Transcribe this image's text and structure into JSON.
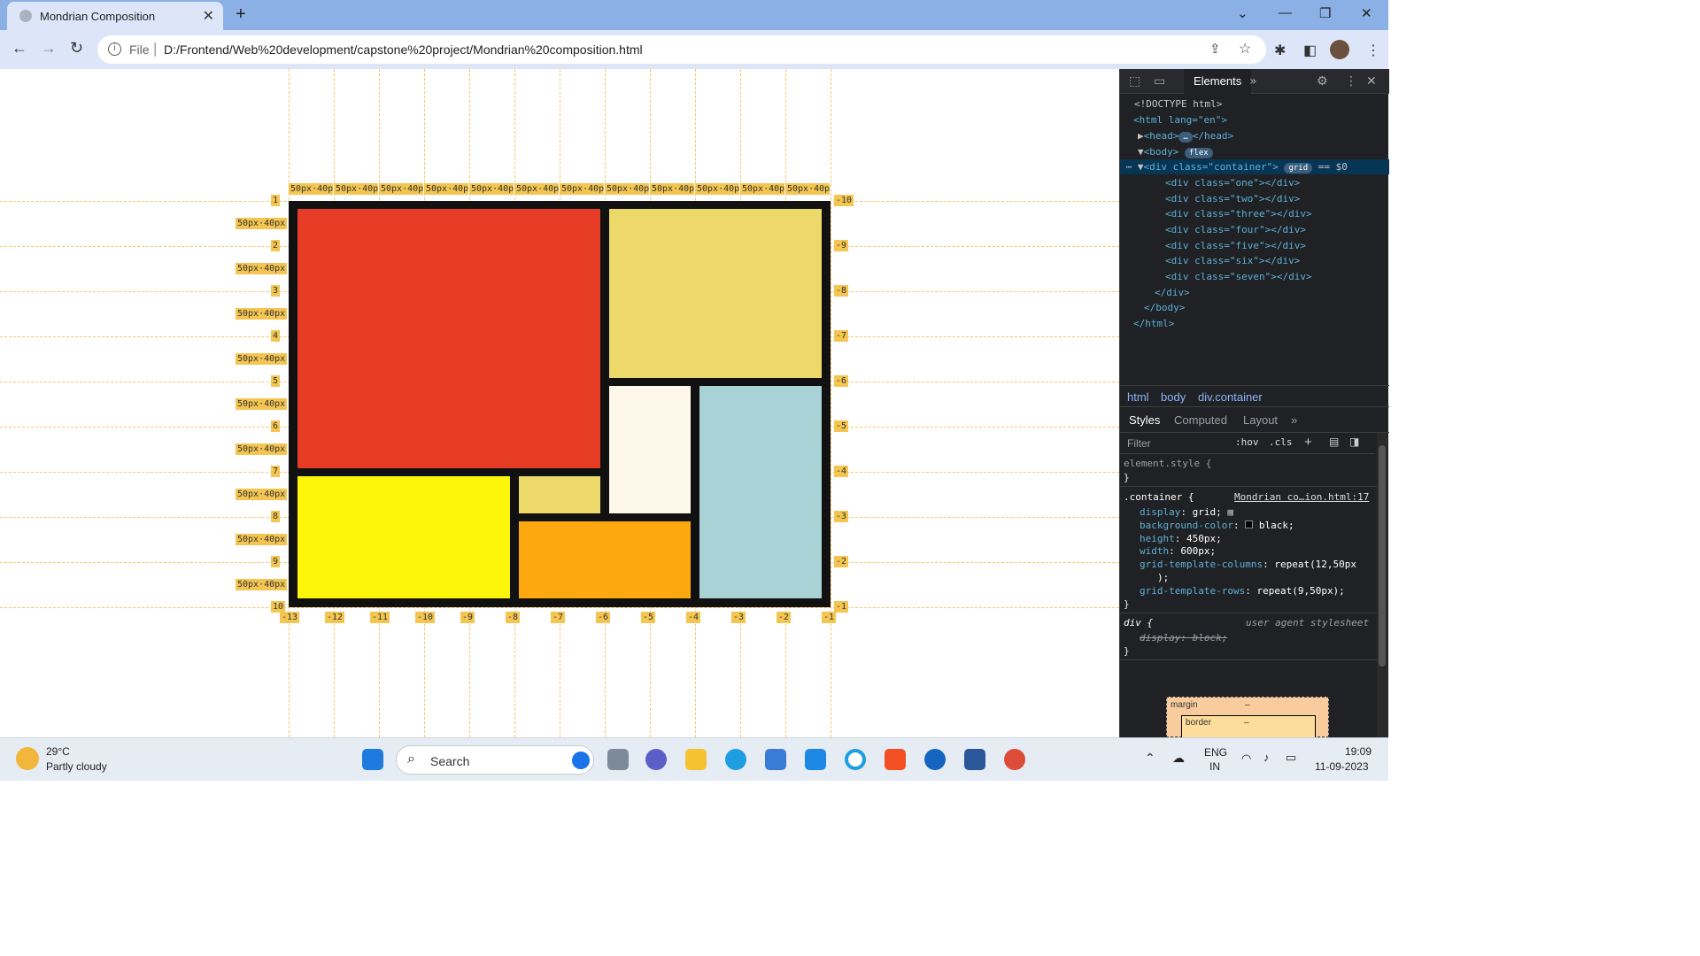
{
  "browser": {
    "tab_title": "Mondrian Composition",
    "new_tab": "+",
    "url_scheme": "File",
    "url": "D:/Frontend/Web%20development/capstone%20project/Mondrian%20composition.html"
  },
  "grid_overlay": {
    "track_label": "50px·40px",
    "row_lines_positive": [
      "1",
      "2",
      "3",
      "4",
      "5",
      "6",
      "7",
      "8",
      "9",
      "10"
    ],
    "row_lines_negative": [
      "-10",
      "-9",
      "-8",
      "-7",
      "-6",
      "-5",
      "-4",
      "-3",
      "-2",
      "-1"
    ],
    "col_lines_negative": [
      "-13",
      "-12",
      "-11",
      "-10",
      "-9",
      "-8",
      "-7",
      "-6",
      "-5",
      "-4",
      "-3",
      "-2",
      "-1"
    ],
    "colors": {
      "red": "#e63c26",
      "light_yellow": "#ecd96a",
      "cream": "#fdf8ea",
      "light_blue": "#a9d2d6",
      "yellow": "#fef60a",
      "orange": "#fda80f"
    }
  },
  "devtools": {
    "panel_tab": "Elements",
    "dom": [
      "<!DOCTYPE html>",
      "<html lang=\"en\">",
      "<head>",
      "</head>",
      "<body>",
      "<div class=\"container\">",
      "== $0",
      "<div class=\"one\"></div>",
      "<div class=\"two\"></div>",
      "<div class=\"three\"></div>",
      "<div class=\"four\"></div>",
      "<div class=\"five\"></div>",
      "<div class=\"six\"></div>",
      "<div class=\"seven\"></div>",
      "</div>",
      "</body>",
      "</html>"
    ],
    "badges": {
      "body": "flex",
      "container": "grid",
      "head_ellipsis": "…"
    },
    "breadcrumbs": [
      "html",
      "body",
      "div.container"
    ],
    "style_tabs": [
      "Styles",
      "Computed",
      "Layout"
    ],
    "filter_placeholder": "Filter",
    "filter_tools": [
      ":hov",
      ".cls"
    ],
    "rules": {
      "element_style": "element.style {",
      "close": "}",
      "container_selector": ".container {",
      "container_source": "Mondrian co…ion.html:17",
      "props": [
        {
          "name": "display",
          "value": "grid;"
        },
        {
          "name": "background-color",
          "value": "black;"
        },
        {
          "name": "height",
          "value": "450px;"
        },
        {
          "name": "width",
          "value": "600px;"
        },
        {
          "name": "grid-template-columns",
          "value": "repeat(12,50px"
        },
        {
          "name": "",
          "value": ");"
        },
        {
          "name": "grid-template-rows",
          "value": "repeat(9,50px);"
        }
      ],
      "div_selector": "div {",
      "ua_label": "user agent stylesheet",
      "ua_prop": "display: block;"
    },
    "box_model": {
      "margin": "margin",
      "border": "border",
      "dash": "–"
    }
  },
  "taskbar": {
    "temperature": "29°C",
    "weather": "Partly cloudy",
    "search": "Search",
    "lang1": "ENG",
    "lang2": "IN",
    "time": "19:09",
    "date": "11-09-2023"
  }
}
